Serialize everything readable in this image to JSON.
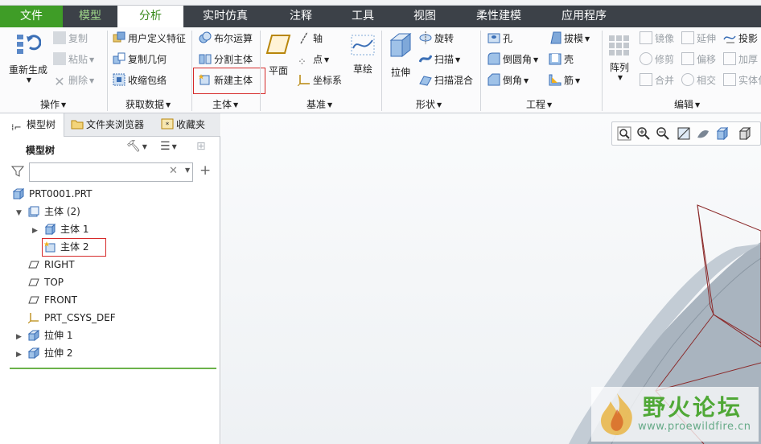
{
  "tabs": [
    "文件",
    "模型",
    "分析",
    "实时仿真",
    "注释",
    "工具",
    "视图",
    "柔性建模",
    "应用程序"
  ],
  "active_tab": "分析",
  "ribbon": {
    "operations": {
      "regenerate": "重新生成",
      "copy": "复制",
      "paste": "粘贴",
      "delete": "删除",
      "label": "操作"
    },
    "get_data": {
      "udf": "用户定义特征",
      "copy_geom": "复制几何",
      "shrinkwrap": "收缩包络",
      "label": "获取数据"
    },
    "body": {
      "boolean": "布尔运算",
      "split": "分割主体",
      "new_body": "新建主体",
      "label": "主体"
    },
    "datum": {
      "plane": "平面",
      "axis": "轴",
      "point": "点",
      "csys": "坐标系",
      "sketch": "草绘",
      "label": "基准"
    },
    "shapes": {
      "extrude": "拉伸",
      "revolve": "旋转",
      "sweep": "扫描",
      "swept_blend": "扫描混合",
      "label": "形状"
    },
    "engineering": {
      "hole": "孔",
      "round": "倒圆角",
      "chamfer": "倒角",
      "draft": "拔模",
      "shell": "壳",
      "rib": "筋",
      "label": "工程"
    },
    "editing": {
      "pattern": "阵列",
      "mirror": "镜像",
      "trim": "修剪",
      "merge": "合并",
      "extend": "延伸",
      "offset": "偏移",
      "intersect": "相交",
      "project": "投影",
      "thicken": "加厚",
      "solidify": "实体化",
      "label": "编辑"
    }
  },
  "panel": {
    "tabs": [
      "模型树",
      "文件夹浏览器",
      "收藏夹"
    ],
    "title": "模型树",
    "filter_value": "",
    "tree": [
      {
        "label": "PRT0001.PRT"
      },
      {
        "label": "主体 (2)"
      },
      {
        "label": "主体 1"
      },
      {
        "label": "主体 2"
      },
      {
        "label": "RIGHT"
      },
      {
        "label": "TOP"
      },
      {
        "label": "FRONT"
      },
      {
        "label": "PRT_CSYS_DEF"
      },
      {
        "label": "拉伸 1"
      },
      {
        "label": "拉伸 2"
      }
    ]
  },
  "watermark": {
    "text": "野火论坛",
    "url": "www.proewildfire.cn"
  },
  "colors": {
    "tabbar": "#3c4148",
    "file_tab": "#3f9d27",
    "active_tab_text": "#3a8a1c",
    "highlight": "#d62a2a",
    "tree_line": "#6bb24a",
    "model": "#a9b4bf"
  }
}
